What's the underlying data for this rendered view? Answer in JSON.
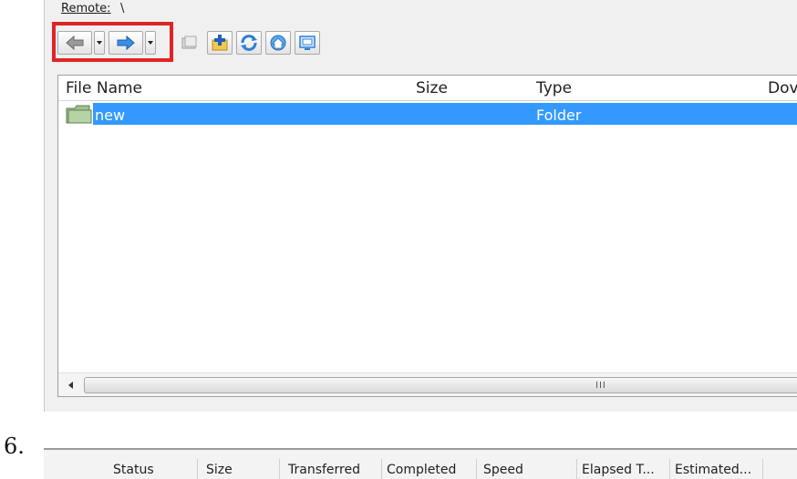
{
  "remote": {
    "label": "Remote:",
    "path": "\\"
  },
  "toolbar": {
    "buttons": [
      {
        "name": "back-button",
        "icon": "back-arrow-icon"
      },
      {
        "name": "back-dropdown",
        "icon": "chevron-down-icon"
      },
      {
        "name": "forward-button",
        "icon": "forward-arrow-icon"
      },
      {
        "name": "forward-dropdown",
        "icon": "chevron-down-icon"
      },
      {
        "name": "parent-folder-button",
        "icon": "parent-folder-icon"
      },
      {
        "name": "new-folder-button",
        "icon": "new-folder-icon"
      },
      {
        "name": "refresh-button",
        "icon": "refresh-icon"
      },
      {
        "name": "home-button",
        "icon": "home-icon"
      },
      {
        "name": "view-button",
        "icon": "view-icon"
      }
    ],
    "highlight_color": "#e02424"
  },
  "file_list": {
    "columns": [
      "File Name",
      "Size",
      "Type",
      "Dov"
    ],
    "rows": [
      {
        "name": "new",
        "size": "",
        "type": "Folder",
        "selected": true
      }
    ],
    "selection_color": "#3399ff"
  },
  "scrollbar": {
    "grip": "III"
  },
  "list_number": "6.",
  "queue": {
    "columns": [
      "Status",
      "Size",
      "Transferred",
      "Completed",
      "Speed",
      "Elapsed T...",
      "Estimated..."
    ]
  }
}
